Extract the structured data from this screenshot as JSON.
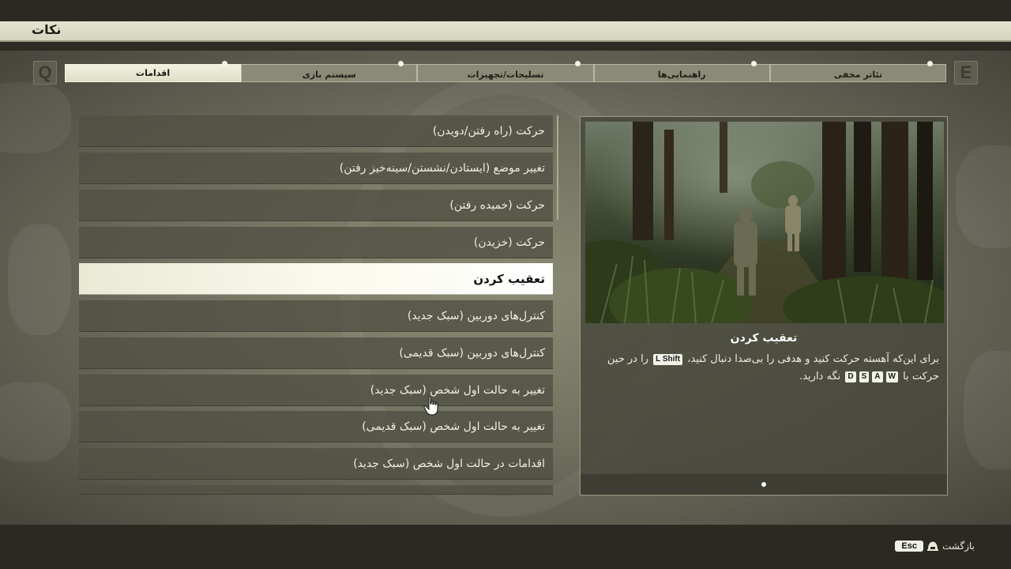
{
  "header": {
    "title": "نکات"
  },
  "tabs": {
    "prev_key": "Q",
    "next_key": "E",
    "items": [
      {
        "label": "اقدامات",
        "active": true
      },
      {
        "label": "سیستم بازی",
        "active": false
      },
      {
        "label": "تسلیحات/تجهیزات",
        "active": false
      },
      {
        "label": "راهنمایی‌ها",
        "active": false
      },
      {
        "label": "تئاتر مخفی",
        "active": false
      }
    ]
  },
  "list": {
    "items": [
      {
        "label": "حرکت (راه رفتن/دویدن)"
      },
      {
        "label": "تغییر موضع (ایستادن/نشستن/سینه‌خیز رفتن)"
      },
      {
        "label": "حرکت (خمیده رفتن)"
      },
      {
        "label": "حرکت (خزیدن)"
      },
      {
        "label": "تعقیب کردن",
        "selected": true
      },
      {
        "label": "کنترل‌های دوربین (سبک جدید)"
      },
      {
        "label": "کنترل‌های دوربین (سبک قدیمی)"
      },
      {
        "label": "تغییر به حالت اول شخص (سبک جدید)"
      },
      {
        "label": "تغییر به حالت اول شخص (سبک قدیمی)"
      },
      {
        "label": "اقدامات در حالت اول شخص (سبک جدید)"
      },
      {
        "label": ""
      }
    ]
  },
  "detail": {
    "title": "تعقیب کردن",
    "desc_part1": "برای این‌که آهسته حرکت کنید و هدفی را بی‌صدا دنبال کنید،",
    "key_shift": "L Shift",
    "desc_part2": "را در حین حرکت با",
    "keys_move": [
      "W",
      "A",
      "S",
      "D"
    ],
    "desc_part3": "نگه دارید."
  },
  "footer": {
    "back_label": "بازگشت",
    "back_key": "Esc"
  }
}
